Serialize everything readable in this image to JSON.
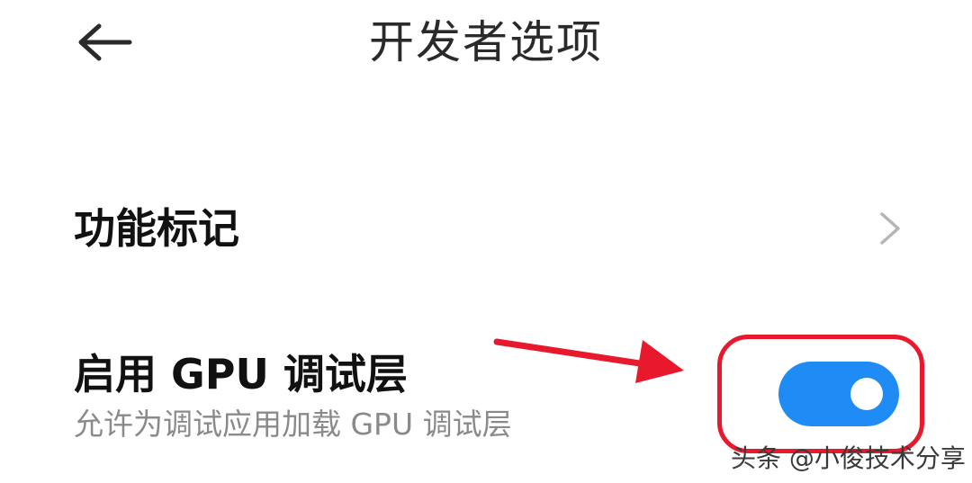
{
  "header": {
    "title": "开发者选项",
    "back_icon": "arrow-left-icon"
  },
  "settings": {
    "feature_flags": {
      "label": "功能标记",
      "icon": "chevron-right-icon"
    },
    "gpu_debug": {
      "label": "启用 GPU 调试层",
      "description": "允许为调试应用加载 GPU 调试层",
      "enabled": true
    }
  },
  "watermark": {
    "text": "头条 @小俊技术分享"
  },
  "colors": {
    "toggle_on": "#1f8bf5",
    "annotation": "#e8192c",
    "chevron": "#b5b5b5"
  }
}
